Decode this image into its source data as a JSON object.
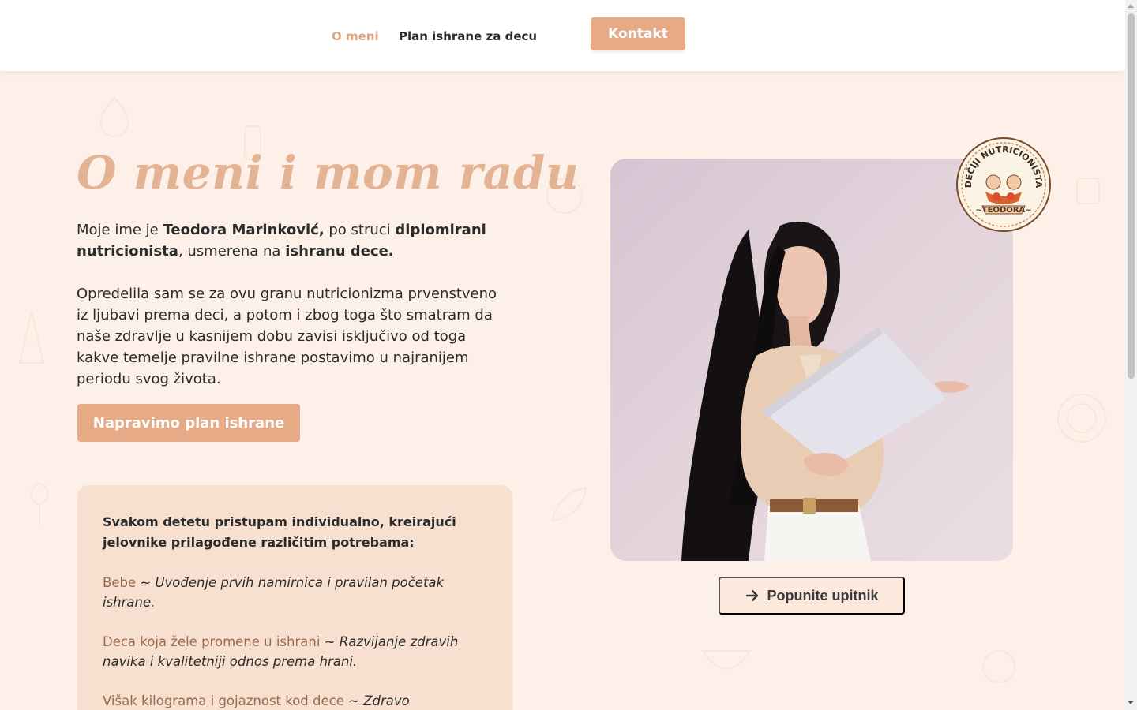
{
  "nav": {
    "items": [
      {
        "label": "O meni",
        "active": true
      },
      {
        "label": "Plan ishrane za decu",
        "active": false
      }
    ],
    "contact_label": "Kontakt"
  },
  "hero": {
    "title": "O meni i mom radu",
    "intro": {
      "t1": "Moje ime je ",
      "name": "Teodora Marinković,",
      "t2": " po struci ",
      "profession": "diplomirani nutricionista",
      "t3": ", usmerena na ",
      "focus": "ishranu dece."
    },
    "paragraph": "Opredelila sam se za ovu granu nutricionizma prvenstveno iz ljubavi prema deci, a potom i zbog toga što smatram da naše zdravlje u kasnijem dobu zavisi isključivo od toga kakve temelje pravilne ishrane postavimo u najranijem periodu svog života.",
    "cta_label": "Napravimo plan ishrane"
  },
  "card": {
    "lead": "Svakom detetu pristupam individualno, kreirajući jelovnike prilagođene različitim potrebama:",
    "items": [
      {
        "term": "Bebe",
        "sep": " ~ ",
        "desc": "Uvođenje prvih namirnica i pravilan početak ishrane."
      },
      {
        "term": "Deca koja žele promene u ishrani",
        "sep": " ~ ",
        "desc": "Razvijanje zdravih navika i kvalitetniji odnos prema hrani."
      },
      {
        "term": "Višak kilograma i gojaznost kod dece",
        "sep": " ~ ",
        "desc": "Zdravo mršavljenje kroz trajne promene navika u ishrani."
      }
    ]
  },
  "badge": {
    "top_text": "DEČIJI NUTRICIONISTA",
    "bottom_text": "~TEODORA~"
  },
  "questionnaire": {
    "label": "Popunite upitnik",
    "icon": "arrow-right-icon"
  },
  "colors": {
    "accent": "#e6ab86",
    "title": "#e3b394",
    "term": "#9a6a4c",
    "background": "#fdf0e8",
    "card": "#f8e0d0"
  }
}
